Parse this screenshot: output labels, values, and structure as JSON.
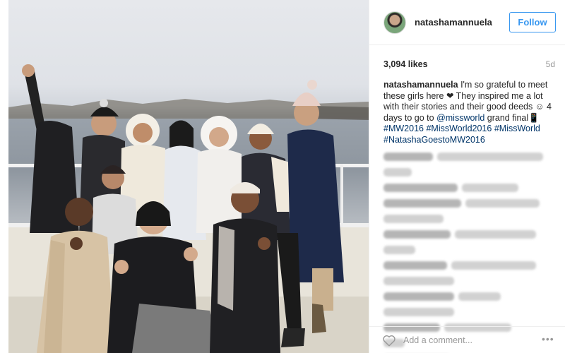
{
  "post": {
    "photo_alt": "Group of women on a boat deck waving"
  },
  "header": {
    "username": "natashamannuela",
    "follow_label": "Follow"
  },
  "meta": {
    "likes": "3,094 likes",
    "age": "5d"
  },
  "caption": {
    "user": "natashamannuela",
    "text_1": " I'm so grateful to meet these girls here ",
    "heart": "❤",
    "text_2": " They inspired me a lot with their stories and their good deeds ",
    "smile": "☺",
    "text_3": " 4 days to go to ",
    "mention": "@missworld",
    "text_4": " grand final",
    "phone": "📱",
    "text_5": " ",
    "tag_1": "#MW2016",
    "tag_2": "#MissWorld2016",
    "tag_3": "#MissWorld",
    "tag_4": "#NatashaGoestoMW2016"
  },
  "footer": {
    "comment_placeholder": "Add a comment...",
    "more": "•••"
  },
  "icons": {
    "heart": "heart-icon",
    "more": "more-options-icon"
  },
  "colors": {
    "accent": "#3897f0",
    "link": "#003569",
    "muted": "#999999"
  }
}
